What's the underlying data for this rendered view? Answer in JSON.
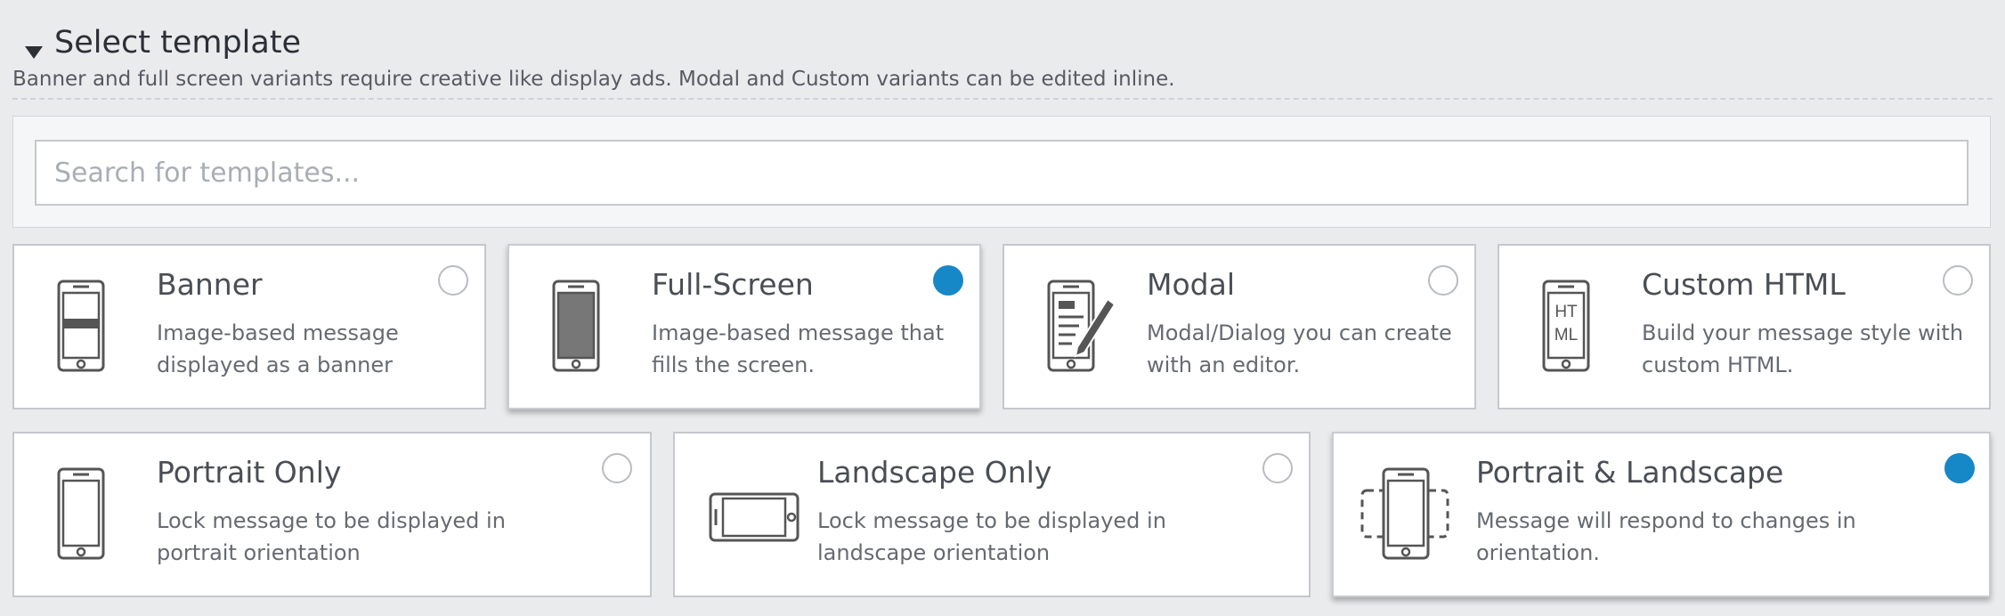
{
  "section": {
    "title": "Select template",
    "subtitle": "Banner and full screen variants require creative like display ads. Modal and Custom variants can be edited inline."
  },
  "search": {
    "placeholder": "Search for templates...",
    "value": ""
  },
  "colors": {
    "accent": "#1788c7",
    "background": "#eaebed"
  },
  "templates": [
    {
      "title": "Banner",
      "description": "Image-based message displayed as a banner",
      "icon": "phone-banner-icon",
      "selected": false
    },
    {
      "title": "Full-Screen",
      "description": "Image-based message that fills the screen.",
      "icon": "phone-fullscreen-icon",
      "selected": true
    },
    {
      "title": "Modal",
      "description": "Modal/Dialog you can create with an editor.",
      "icon": "phone-edit-icon",
      "selected": false
    },
    {
      "title": "Custom HTML",
      "description": "Build your message style with custom HTML.",
      "icon": "phone-html-icon",
      "selected": false
    }
  ],
  "orientations": [
    {
      "title": "Portrait Only",
      "description": "Lock message to be displayed in portrait orientation",
      "icon": "phone-portrait-icon",
      "selected": false
    },
    {
      "title": "Landscape Only",
      "description": "Lock message to be displayed in landscape orientation",
      "icon": "phone-landscape-icon",
      "selected": false
    },
    {
      "title": "Portrait & Landscape",
      "description": "Message will respond to changes in orientation.",
      "icon": "phone-rotate-icon",
      "selected": true
    }
  ],
  "icon_text": {
    "html_line1": "HT",
    "html_line2": "ML"
  }
}
